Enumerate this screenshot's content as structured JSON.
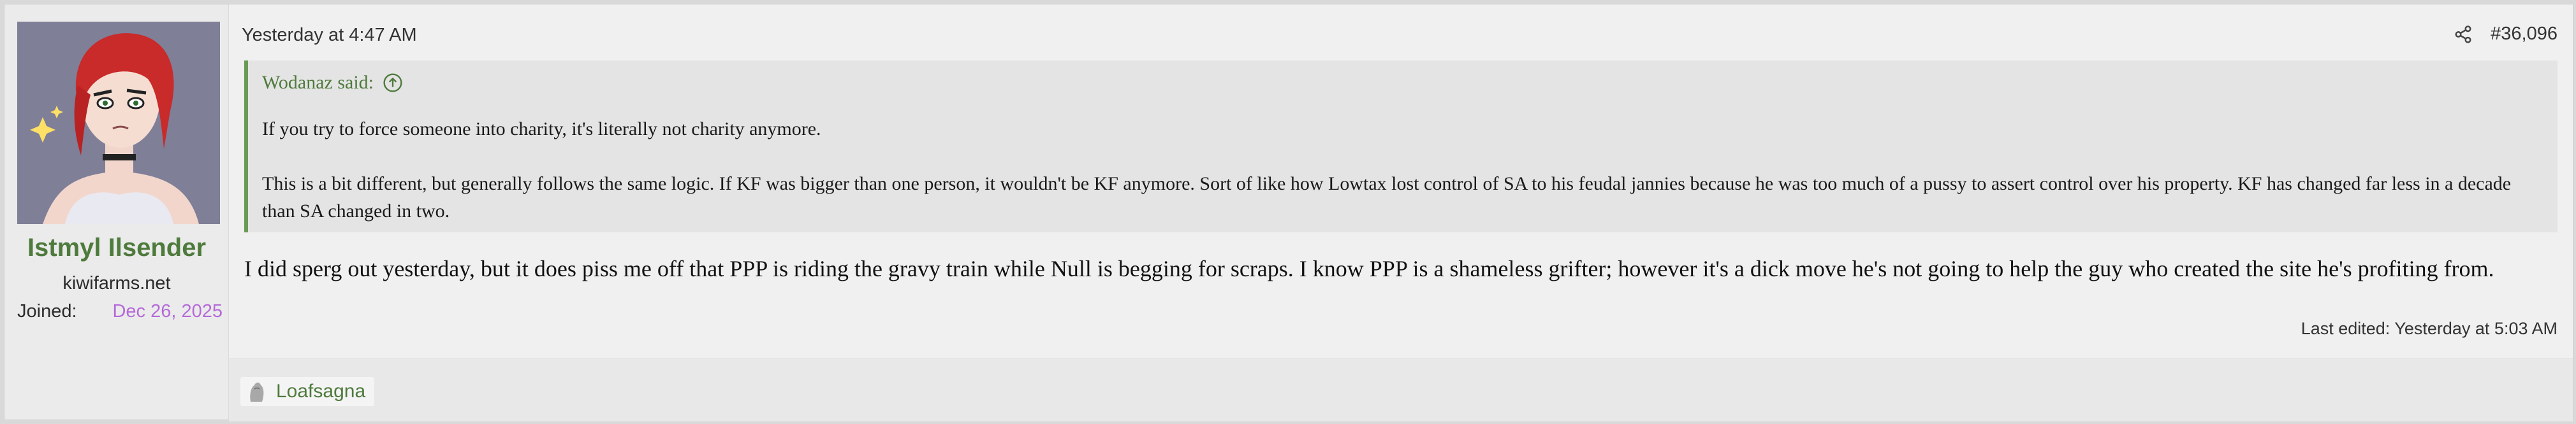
{
  "post": {
    "author": {
      "name": "Istmyl Ilsender",
      "title": "kiwifarms.net",
      "joined_label": "Joined:",
      "joined_date": "Dec 26, 2025"
    },
    "timestamp": "Yesterday at 4:47 AM",
    "post_number": "#36,096",
    "quote": {
      "author_said": "Wodanaz said:",
      "paragraphs": [
        "If you try to force someone into charity, it's literally not charity anymore.",
        "This is a bit different, but generally follows the same logic. If KF was bigger than one person, it wouldn't be KF anymore. Sort of like how Lowtax lost control of SA to his feudal jannies because he was too much of a pussy to assert control over his property. KF has changed far less in a decade than SA changed in two."
      ]
    },
    "body": "I did sperg out yesterday, but it does piss me off that PPP is riding the gravy train while Null is begging for scraps. I know PPP is a shameless grifter; however it's a dick move he's not going to help the guy who created the site he's profiting from.",
    "last_edited": "Last edited: Yesterday at 5:03 AM",
    "reactions": [
      {
        "icon": "reaction-icon",
        "user": "Loafsagna"
      }
    ]
  },
  "colors": {
    "username": "#4e7a3c",
    "joined_date": "#b56ad8",
    "quote_border": "#6a9a55"
  }
}
